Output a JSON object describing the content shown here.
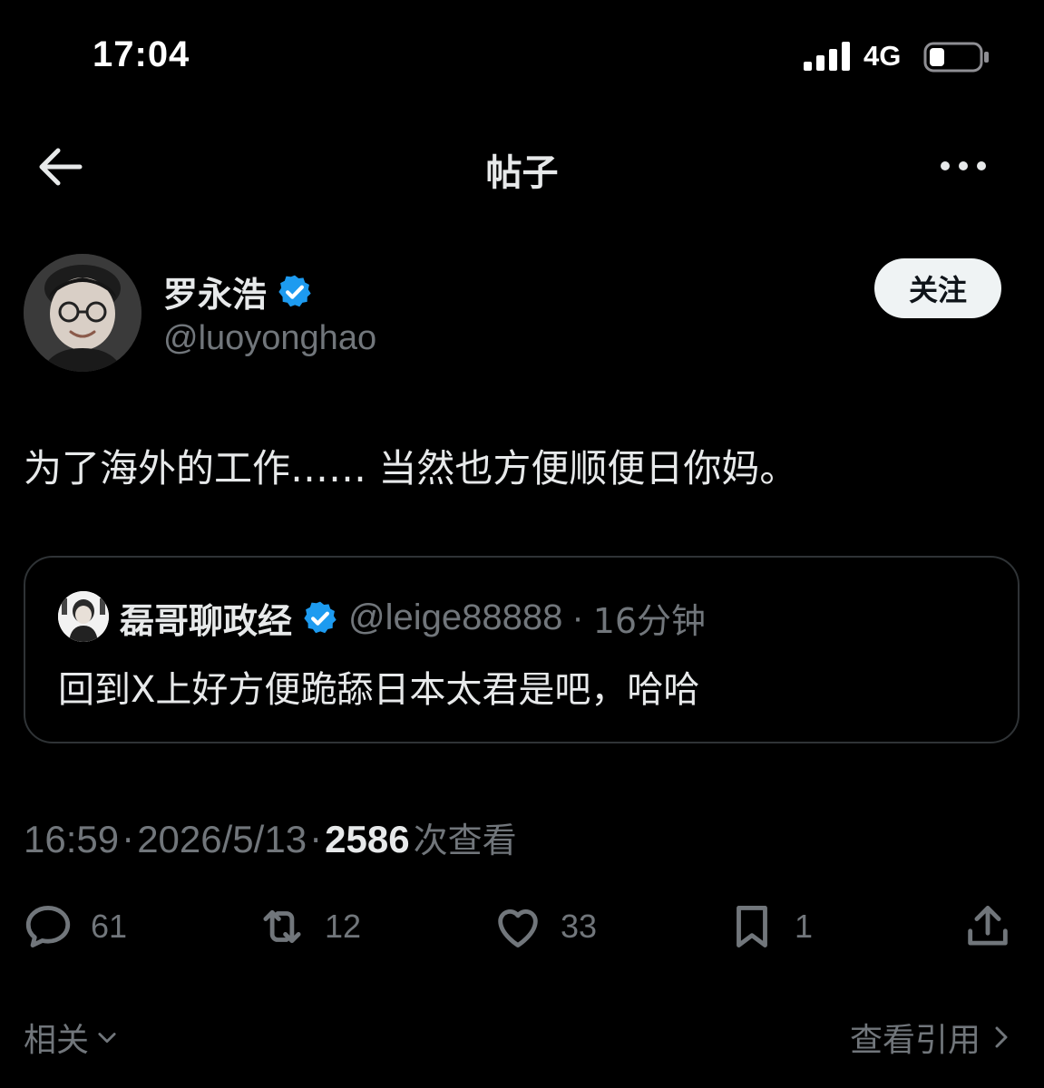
{
  "status_bar": {
    "time": "17:04",
    "network": "4G",
    "icons": [
      "signal-bars-icon",
      "battery-icon"
    ]
  },
  "header": {
    "title": "帖子",
    "back_icon": "arrow-left-icon",
    "more_icon": "more-horizontal-icon"
  },
  "author": {
    "name": "罗永浩",
    "handle": "@luoyonghao",
    "verified": true,
    "follow_label": "关注"
  },
  "post": {
    "text": "为了海外的工作…… 当然也方便顺便日你妈。"
  },
  "quote": {
    "name": "磊哥聊政经",
    "handle": "@leige88888",
    "separator": "·",
    "time": "16分钟",
    "text": "回到X上好方便跪舔日本太君是吧，哈哈"
  },
  "meta": {
    "time": "16:59",
    "sep1": "·",
    "date": "2026/5/13",
    "sep2": "·",
    "views": "2586",
    "views_label": "次查看"
  },
  "actions": {
    "replies": "61",
    "reposts": "12",
    "likes": "33",
    "bookmarks": "1"
  },
  "footer": {
    "related_label": "相关",
    "view_quotes_label": "查看引用"
  },
  "colors": {
    "background": "#000000",
    "text_primary": "#e7e9ea",
    "text_secondary": "#71767b",
    "verified_blue": "#1d9bf0",
    "border": "#2f3336"
  }
}
